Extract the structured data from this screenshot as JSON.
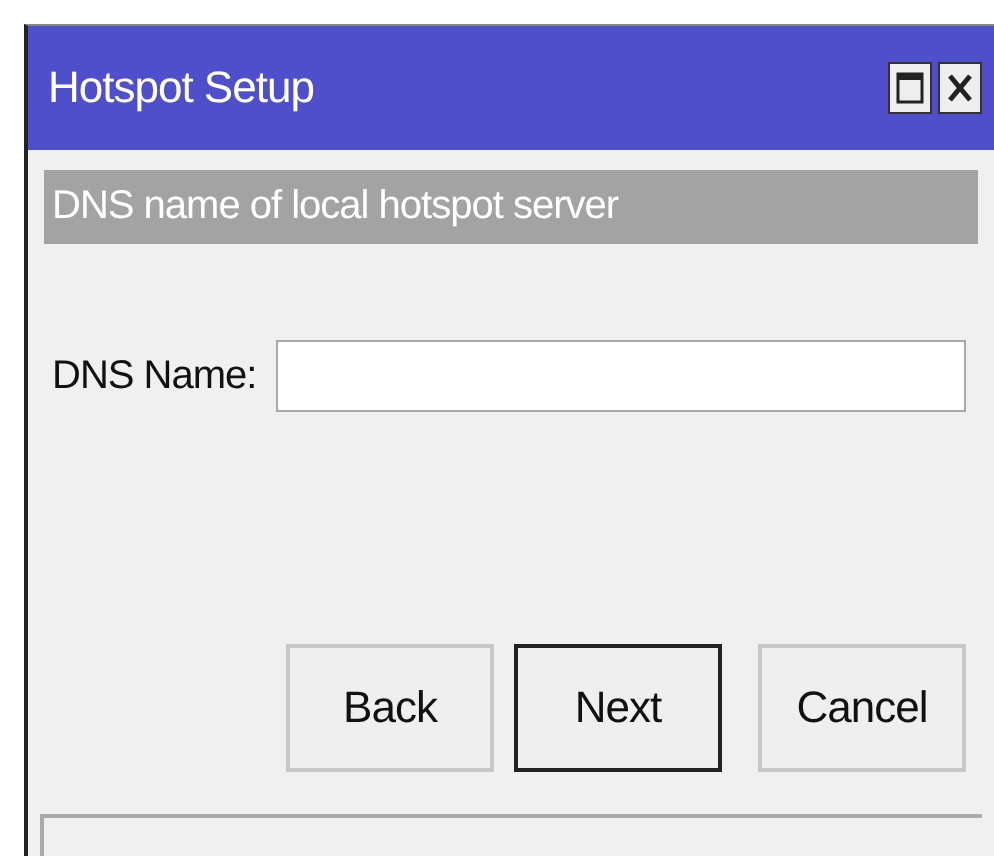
{
  "window": {
    "title": "Hotspot Setup"
  },
  "section_header": "DNS name of local hotspot server",
  "field": {
    "label": "DNS Name:"
  },
  "buttons": [
    {
      "label": "Back",
      "default": false
    },
    {
      "label": "Next",
      "default": true
    },
    {
      "label": "Cancel",
      "default": false
    }
  ]
}
